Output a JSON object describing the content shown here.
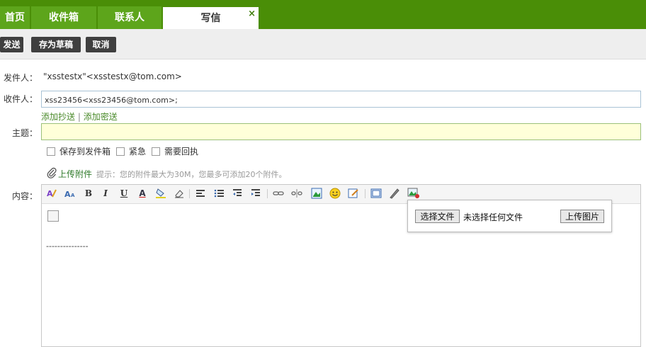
{
  "tabs": [
    {
      "label": "首页"
    },
    {
      "label": "收件箱"
    },
    {
      "label": "联系人"
    },
    {
      "label": "写信",
      "close": "×"
    }
  ],
  "toolbar": {
    "send": "发送",
    "save_draft": "存为草稿",
    "cancel": "取消"
  },
  "form": {
    "sender_label": "发件人：",
    "sender_value": "\"xsstestx\"<xsstestx@tom.com>",
    "to_label": "收件人：",
    "to_value": "xss23456<xss23456@tom.com>;",
    "add_cc": "添加抄送",
    "link_sep": "|",
    "add_bcc": "添加密送",
    "subject_label": "主题：",
    "subject_value": "",
    "options": [
      "保存到发件箱",
      "紧急",
      "需要回执"
    ],
    "upload_attachment": "上传附件",
    "upload_hint": "提示：您的附件最大为30M，您最多可添加20个附件。",
    "content_label": "内容："
  },
  "editor": {
    "body_line": "---------------",
    "tools": {
      "bold": "B",
      "italic": "I",
      "underline": "U",
      "font_color": "A"
    }
  },
  "upload_popup": {
    "choose_file": "选择文件",
    "no_file": "未选择任何文件",
    "upload_image": "上传图片"
  },
  "colors": {
    "tab_bar": "#4a8e07",
    "tab": "#5da51b",
    "button": "#3f3f3f",
    "link": "#4a8a2a",
    "subject_bg": "#ffffd9"
  }
}
